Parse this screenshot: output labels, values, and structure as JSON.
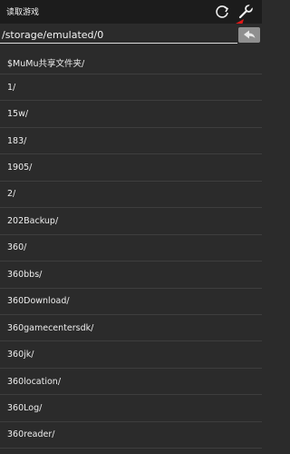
{
  "titlebar": {
    "title": "读取游戏",
    "refresh_icon": "refresh-icon",
    "settings_icon": "wrench-icon"
  },
  "path": {
    "value": "/storage/emulated/0",
    "back_icon": "back-arrow-icon"
  },
  "folders": [
    "$MuMu共享文件夹/",
    "1/",
    "15w/",
    "183/",
    "1905/",
    "2/",
    "202Backup/",
    "360/",
    "360bbs/",
    "360Download/",
    "360gamecentersdk/",
    "360jk/",
    "360location/",
    "360Log/",
    "360reader/"
  ],
  "colors": {
    "background": "#2b2b2b",
    "titlebar": "#1c1c1c",
    "annotation_arrow": "#e01818"
  }
}
